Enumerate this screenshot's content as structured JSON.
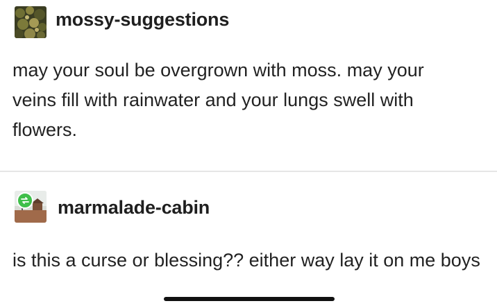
{
  "posts": [
    {
      "username": "mossy-suggestions",
      "avatar_icon": "moss-avatar-icon",
      "text": "may your soul be overgrown with moss. may your veins fill with rainwater and your lungs swell with flowers."
    },
    {
      "username": "marmalade-cabin",
      "avatar_icon": "cabin-avatar-icon",
      "badge_icon": "reblog-icon",
      "text": "is this a curse or blessing?? either way lay it on me boys"
    }
  ],
  "colors": {
    "text": "#222222",
    "divider": "#e6e6e6",
    "reblog_badge": "#3fbf4a"
  }
}
